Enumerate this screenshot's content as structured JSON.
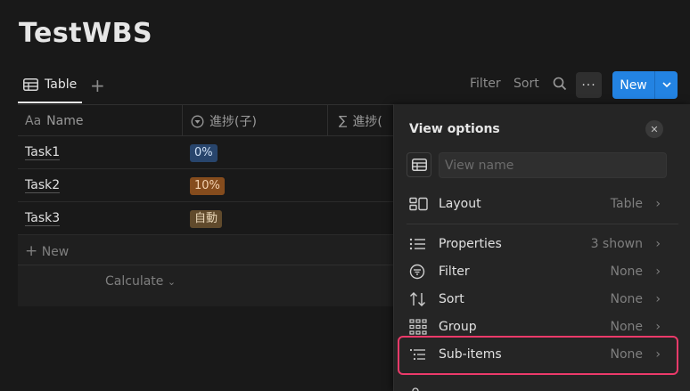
{
  "page": {
    "title": "TestWBS"
  },
  "toolbar": {
    "view_tab": "Table",
    "filter": "Filter",
    "sort": "Sort",
    "more": "···",
    "new": "New"
  },
  "table": {
    "columns": [
      {
        "prefix": "Aa",
        "label": "Name"
      },
      {
        "label": "進捗(子)"
      },
      {
        "label": "進捗("
      }
    ],
    "rows": [
      {
        "name": "Task1",
        "tag": "0%"
      },
      {
        "name": "Task2",
        "tag": "10%"
      },
      {
        "name": "Task3",
        "tag": "自動"
      }
    ],
    "new_row": "New",
    "calculate": "Calculate"
  },
  "panel": {
    "title": "View options",
    "view_name_placeholder": "View name",
    "layout": {
      "label": "Layout",
      "value": "Table"
    },
    "properties": {
      "label": "Properties",
      "value": "3 shown"
    },
    "filter": {
      "label": "Filter",
      "value": "None"
    },
    "sort": {
      "label": "Sort",
      "value": "None"
    },
    "group": {
      "label": "Group",
      "value": "None"
    },
    "subitems": {
      "label": "Sub-items",
      "value": "None"
    }
  },
  "colors": {
    "accent": "#2383e2",
    "highlight": "#ec3a6a",
    "background": "#191919",
    "panel": "#252525"
  }
}
